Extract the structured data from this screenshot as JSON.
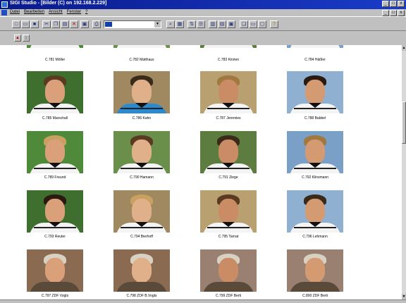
{
  "window": {
    "title": "SIGI Studio - [Bilder (C) on 192.168.2.229]",
    "buttons": [
      "_",
      "□",
      "x"
    ]
  },
  "menubar": {
    "items": [
      "Datei",
      "Bearbeiten",
      "Ansicht",
      "Fenster",
      "?"
    ]
  },
  "toolbar": {
    "combo_value": ""
  },
  "thumbnails": [
    {
      "caption": "C.781 Möller"
    },
    {
      "caption": "C.782 Matthaus"
    },
    {
      "caption": "C.783 Kirsten"
    },
    {
      "caption": "C.784 Häßler"
    },
    {
      "caption": "C.785 Marschall"
    },
    {
      "caption": "C.786 Kahn"
    },
    {
      "caption": "C.787 Jeremies"
    },
    {
      "caption": "C.788 Babbel"
    },
    {
      "caption": "C.789 Freund"
    },
    {
      "caption": "C.790 Hamann"
    },
    {
      "caption": "C.791 Ziege"
    },
    {
      "caption": "C.792 Klinsmann"
    },
    {
      "caption": "C.793 Reuter"
    },
    {
      "caption": "C.794 Bierhoff"
    },
    {
      "caption": "C.795 Tarnat"
    },
    {
      "caption": "C.796 Lehmann"
    },
    {
      "caption": "C.797 ZDF Vogts"
    },
    {
      "caption": "C.798 ZDF B.Vogts"
    },
    {
      "caption": "C.799 ZDF Berti"
    },
    {
      "caption": "C.800 ZDF Berti"
    }
  ]
}
